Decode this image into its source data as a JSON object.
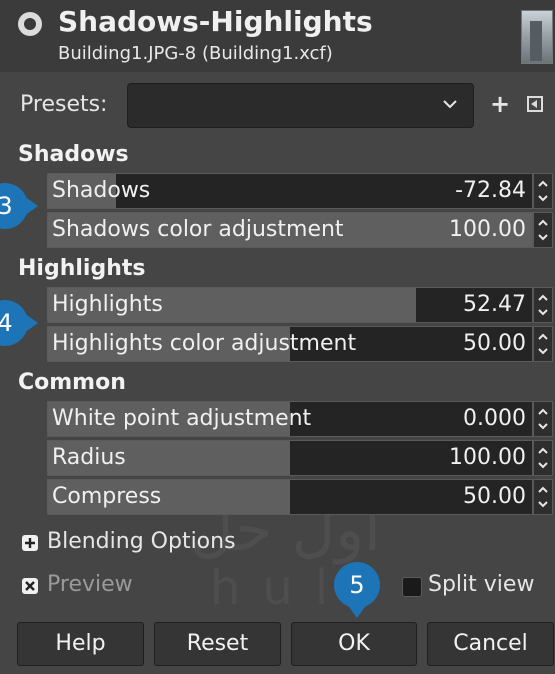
{
  "header": {
    "title": "Shadows-Highlights",
    "subtitle": "Building1.JPG-8 (Building1.xcf)",
    "logo_icon": "gimp-filter-icon",
    "thumbnail": "image-thumbnail"
  },
  "presets": {
    "label": "Presets:",
    "value": "",
    "add_icon": "+",
    "menu_icon": "presets-menu-icon"
  },
  "sections": {
    "shadows": "Shadows",
    "highlights": "Highlights",
    "common": "Common"
  },
  "sliders": {
    "shadows": {
      "label": "Shadows",
      "value": "-72.84",
      "level": 0.14
    },
    "shadows_color": {
      "label": "Shadows color adjustment",
      "value": "100.00",
      "level": 1.0
    },
    "highlights": {
      "label": "Highlights",
      "value": "52.47",
      "level": 0.76
    },
    "highlights_color": {
      "label": "Highlights color adjustment",
      "value": "50.00",
      "level": 0.5
    },
    "white_point": {
      "label": "White point adjustment",
      "value": "0.000",
      "level": 0.5
    },
    "radius": {
      "label": "Radius",
      "value": "100.00",
      "level": 0.5
    },
    "compress": {
      "label": "Compress",
      "value": "50.00",
      "level": 0.5
    }
  },
  "blending": {
    "label": "Blending Options",
    "icon": "expand-plus-icon"
  },
  "preview": {
    "label": "Preview",
    "checked": true
  },
  "split_view": {
    "label": "Split view",
    "checked": false
  },
  "buttons": {
    "help": "Help",
    "reset": "Reset",
    "ok": "OK",
    "cancel": "Cancel"
  },
  "callouts": [
    "3",
    "4",
    "5"
  ],
  "colors": {
    "background": "#454545",
    "accent": "#1d74b6"
  }
}
